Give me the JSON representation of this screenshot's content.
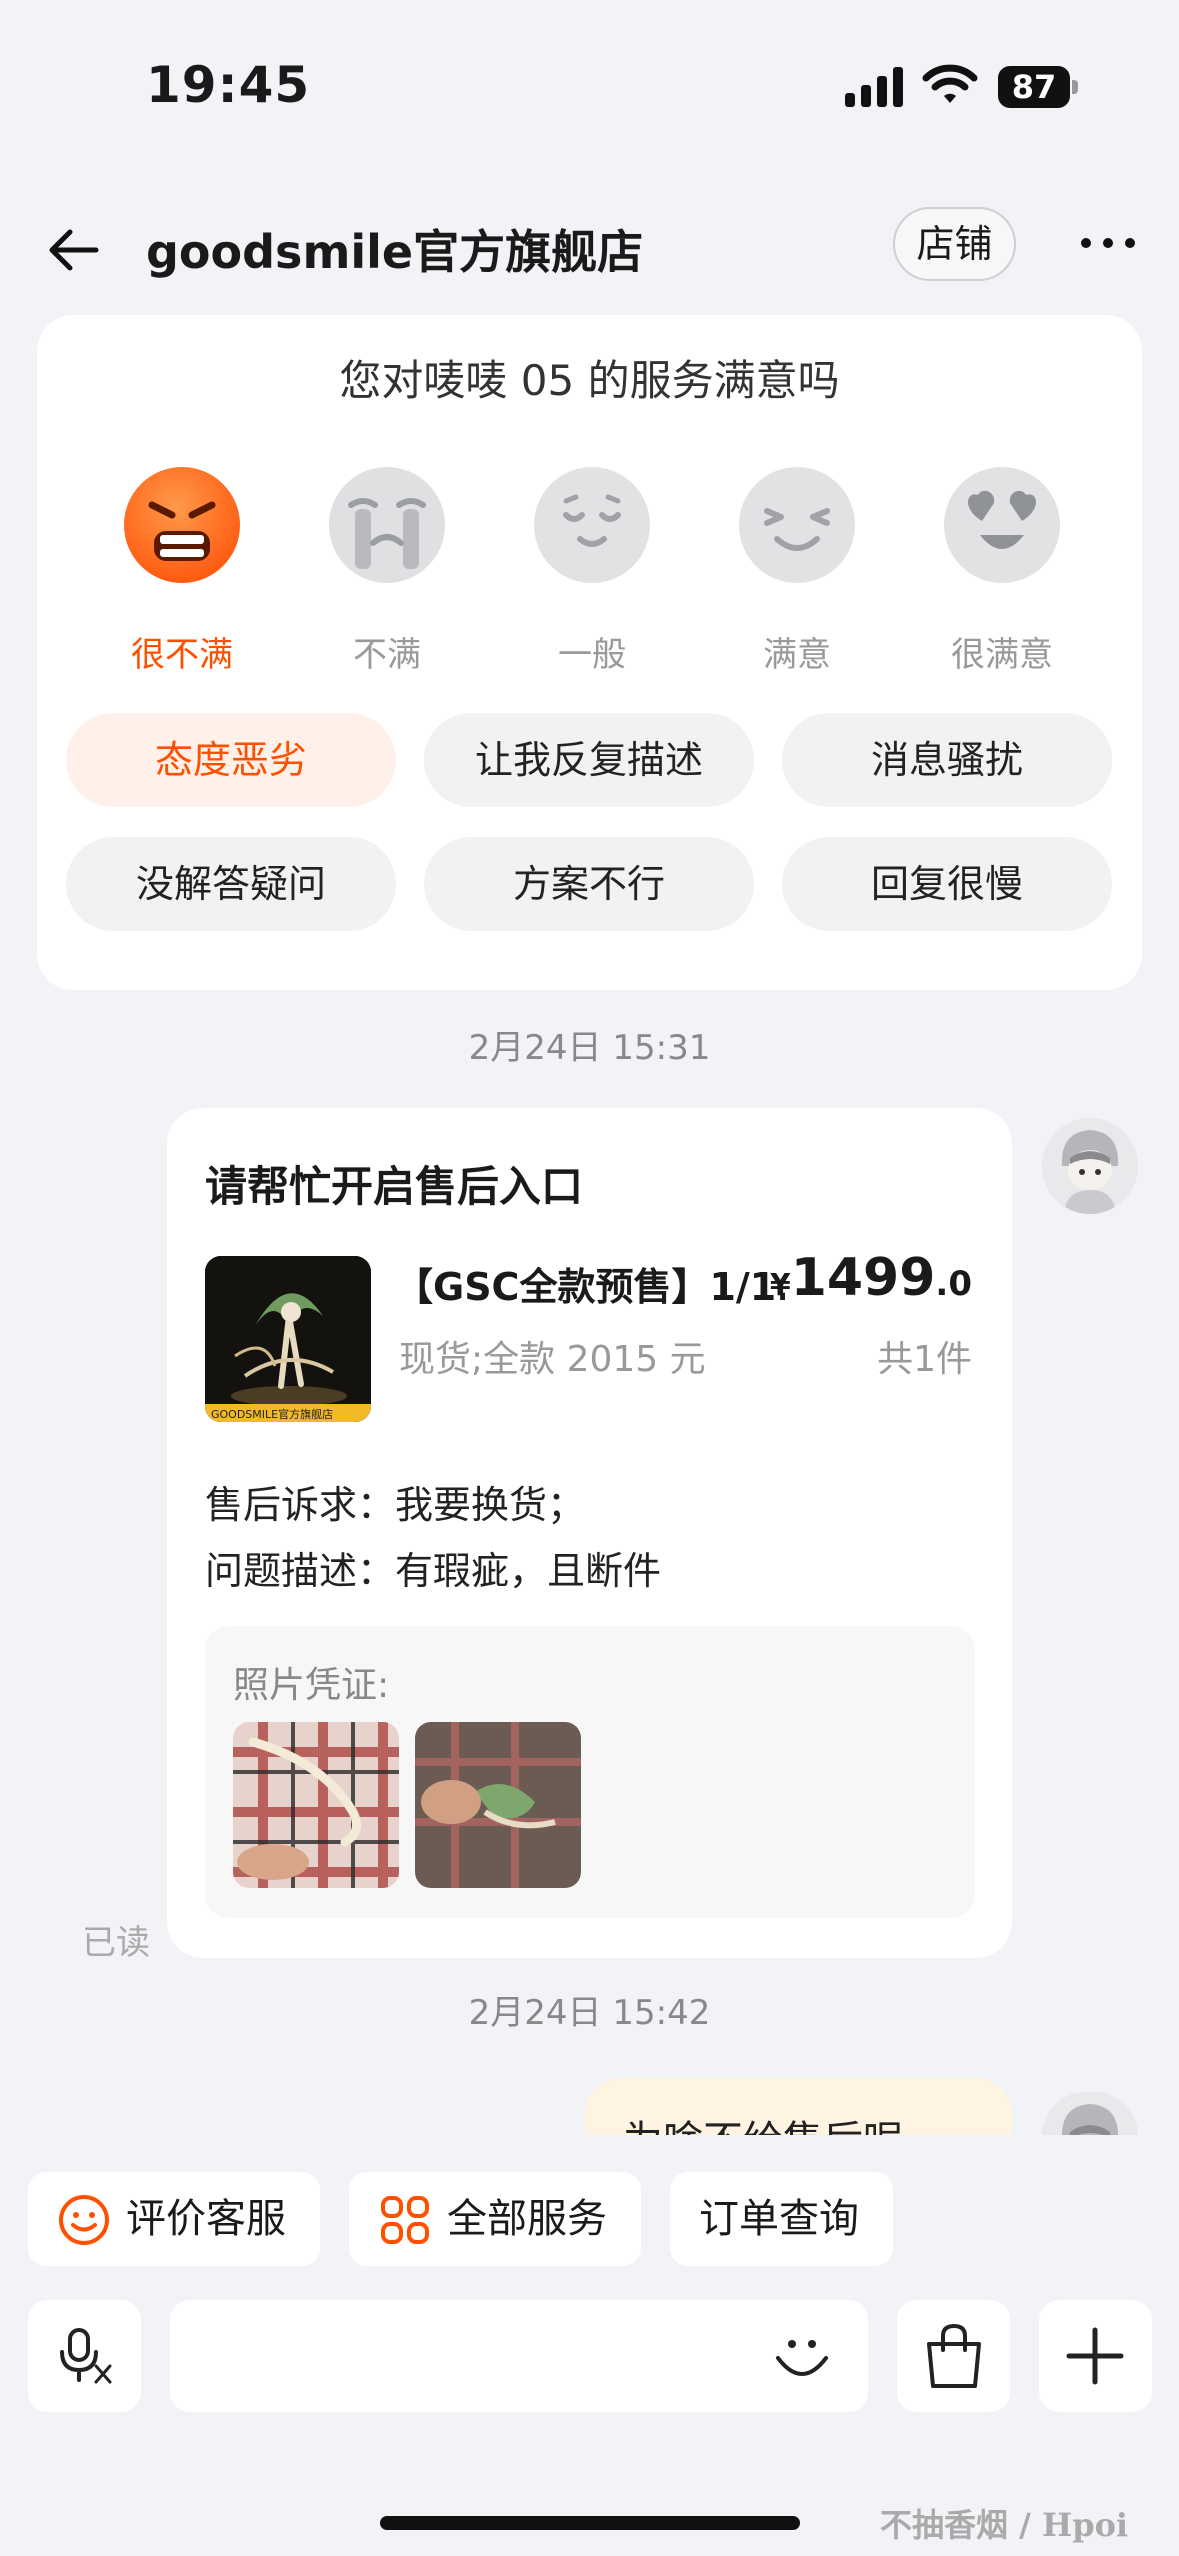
{
  "status": {
    "time": "19:45",
    "battery": "87"
  },
  "nav": {
    "title": "goodsmile官方旗舰店",
    "store_btn": "店铺"
  },
  "rating": {
    "question": "您对唛唛 05 的服务满意吗",
    "faces": [
      {
        "label": "很不满",
        "icon": "very-unsatisfied-face-icon",
        "active": true
      },
      {
        "label": "不满",
        "icon": "unsatisfied-face-icon",
        "active": false
      },
      {
        "label": "一般",
        "icon": "neutral-face-icon",
        "active": false
      },
      {
        "label": "满意",
        "icon": "satisfied-face-icon",
        "active": false
      },
      {
        "label": "很满意",
        "icon": "very-satisfied-face-icon",
        "active": false
      }
    ],
    "tags": [
      "态度恶劣",
      "让我反复描述",
      "消息骚扰",
      "没解答疑问",
      "方案不行",
      "回复很慢"
    ],
    "active_tag": "态度恶劣",
    "accent": "#ff5000"
  },
  "messages": {
    "timestamp1": "2月24日 15:31",
    "card": {
      "title": "请帮忙开启售后入口",
      "product_name": "【GSC全款预售】1/1...",
      "price_currency": "¥",
      "price_int": "1499",
      "price_dec": ".0",
      "spec": "现货;全款 2015 元",
      "qty": "共1件",
      "claim_label": "售后诉求：",
      "claim_value": "我要换货；",
      "desc_label": "问题描述：",
      "desc_value": "有瑕疵，且断件",
      "proof_label": "照片凭证:",
      "product_image_text": "GOODSMILE官方旗舰店"
    },
    "read": "已读",
    "timestamp2": "2月24日 15:42",
    "bubble_text": "为啥不给售后呢"
  },
  "bottom": {
    "quick_actions": [
      {
        "label": "评价客服",
        "icon": "smile-icon"
      },
      {
        "label": "全部服务",
        "icon": "grid-icon"
      },
      {
        "label": "订单查询",
        "icon": ""
      }
    ],
    "icons": [
      "voice-translate-icon",
      "emoji-icon",
      "shopping-bag-icon",
      "plus-icon"
    ]
  },
  "watermark": "不抽香烟 / Hpoi"
}
